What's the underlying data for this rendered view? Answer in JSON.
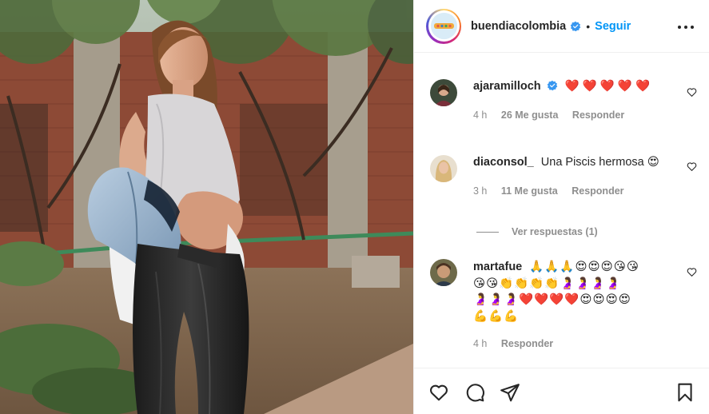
{
  "post": {
    "username": "buendiacolombia",
    "follow_label": "Seguir",
    "separator": "•",
    "photo_alt": "Mujer embarazada posando en un jardín"
  },
  "comments": [
    {
      "username": "ajaramilloch",
      "verified": true,
      "text": "❤️ ❤️ ❤️ ❤️ ❤️",
      "time": "4 h",
      "likes": "26 Me gusta",
      "reply": "Responder"
    },
    {
      "username": "diaconsol_",
      "verified": false,
      "text": "Una Piscis hermosa 😍",
      "time": "3 h",
      "likes": "11 Me gusta",
      "reply": "Responder",
      "view_replies": "Ver respuestas (1)"
    },
    {
      "username": "martafue",
      "verified": false,
      "line1": "🙏🙏🙏😍😍😍😘😘",
      "line2": "😘😘👏👏👏👏🤰🤰🤰🤰",
      "line3": "🤰🤰🤰❤️❤️❤️❤️😍😍😍😍",
      "line4": "💪💪💪",
      "time": "4 h",
      "reply": "Responder"
    }
  ],
  "icons": {
    "like": "heart-icon",
    "comment": "comment-icon",
    "share": "share-icon",
    "save": "bookmark-icon",
    "options": "more-icon",
    "verified": "verified-badge-icon"
  },
  "colors": {
    "accent": "#0095f6",
    "text": "#262626",
    "muted": "#8e8e8e",
    "border": "#efefef"
  }
}
